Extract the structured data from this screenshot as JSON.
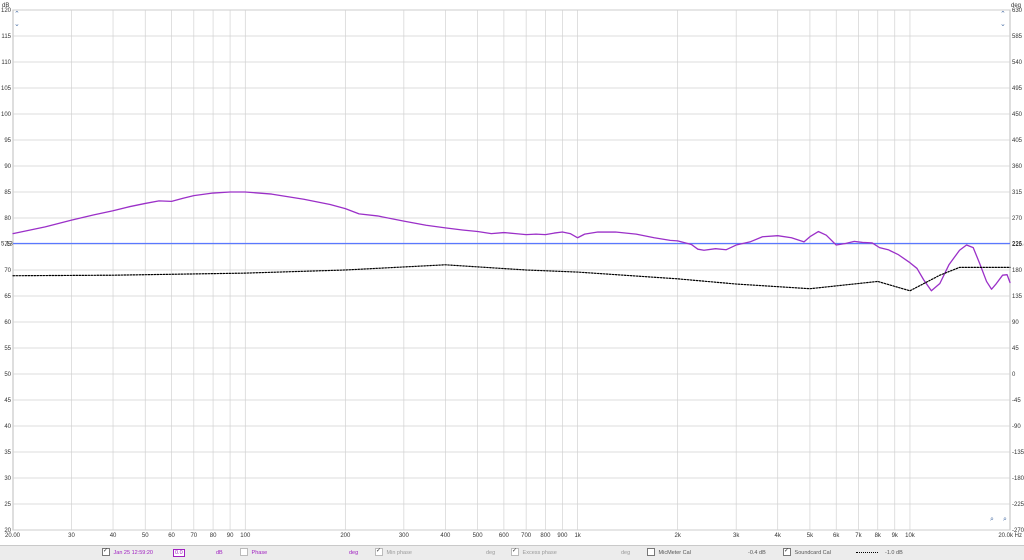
{
  "chart_data": {
    "type": "line",
    "xscale": "log",
    "xlim": [
      20,
      20000
    ],
    "ylim_left": [
      20,
      120
    ],
    "ylim_right": [
      -270,
      630
    ],
    "yaxis_left_unit": "dB",
    "yaxis_right_unit": "deg",
    "x_ticks": [
      {
        "v": 30,
        "label": "30"
      },
      {
        "v": 40,
        "label": "40"
      },
      {
        "v": 50,
        "label": "50"
      },
      {
        "v": 60,
        "label": "60"
      },
      {
        "v": 70,
        "label": "70"
      },
      {
        "v": 80,
        "label": "80"
      },
      {
        "v": 90,
        "label": "90"
      },
      {
        "v": 100,
        "label": "100"
      },
      {
        "v": 200,
        "label": "200"
      },
      {
        "v": 300,
        "label": "300"
      },
      {
        "v": 400,
        "label": "400"
      },
      {
        "v": 500,
        "label": "500"
      },
      {
        "v": 600,
        "label": "600"
      },
      {
        "v": 700,
        "label": "700"
      },
      {
        "v": 800,
        "label": "800"
      },
      {
        "v": 900,
        "label": "900"
      },
      {
        "v": 1000,
        "label": "1k"
      },
      {
        "v": 2000,
        "label": "2k"
      },
      {
        "v": 3000,
        "label": "3k"
      },
      {
        "v": 4000,
        "label": "4k"
      },
      {
        "v": 5000,
        "label": "5k"
      },
      {
        "v": 6000,
        "label": "6k"
      },
      {
        "v": 7000,
        "label": "7k"
      },
      {
        "v": 8000,
        "label": "8k"
      },
      {
        "v": 9000,
        "label": "9k"
      },
      {
        "v": 10000,
        "label": "10k"
      }
    ],
    "x_min_label": "20.00",
    "x_max_label": "20.0k Hz",
    "y_left_ticks": [
      "120",
      "115",
      "110",
      "105",
      "100",
      "95",
      "90",
      "85",
      "80",
      "75",
      "70",
      "65",
      "60",
      "55",
      "50",
      "45",
      "40",
      "35",
      "30",
      "25",
      "20"
    ],
    "y_right_ticks": [
      "630",
      "585",
      "540",
      "495",
      "450",
      "405",
      "360",
      "315",
      "270",
      "225",
      "180",
      "135",
      "90",
      "45",
      "0",
      "-45",
      "-90",
      "-135",
      "-180",
      "-225",
      "-270"
    ],
    "y_left_top_unit_label": "dB",
    "y_right_top_unit_label": "deg",
    "cursor_level_left": 75.1,
    "cursor_level_right": 226.4,
    "cursor_label_left": "5.13",
    "cursor_label_right": "226.4",
    "series": [
      {
        "name": "Jan 25 12:59:20",
        "color": "#9b30c8",
        "style": "solid",
        "points": [
          [
            20,
            77.0
          ],
          [
            25,
            78.3
          ],
          [
            30,
            79.6
          ],
          [
            35,
            80.6
          ],
          [
            40,
            81.4
          ],
          [
            45,
            82.2
          ],
          [
            50,
            82.8
          ],
          [
            55,
            83.3
          ],
          [
            60,
            83.2
          ],
          [
            65,
            83.8
          ],
          [
            70,
            84.3
          ],
          [
            80,
            84.8
          ],
          [
            90,
            85.0
          ],
          [
            100,
            85.0
          ],
          [
            120,
            84.6
          ],
          [
            150,
            83.6
          ],
          [
            180,
            82.6
          ],
          [
            200,
            81.8
          ],
          [
            220,
            80.8
          ],
          [
            250,
            80.4
          ],
          [
            300,
            79.4
          ],
          [
            350,
            78.6
          ],
          [
            400,
            78.1
          ],
          [
            450,
            77.7
          ],
          [
            500,
            77.4
          ],
          [
            550,
            77.0
          ],
          [
            600,
            77.2
          ],
          [
            650,
            77.0
          ],
          [
            700,
            76.8
          ],
          [
            750,
            76.9
          ],
          [
            800,
            76.8
          ],
          [
            850,
            77.1
          ],
          [
            900,
            77.3
          ],
          [
            950,
            77.0
          ],
          [
            1000,
            76.2
          ],
          [
            1050,
            76.9
          ],
          [
            1150,
            77.3
          ],
          [
            1300,
            77.3
          ],
          [
            1500,
            76.9
          ],
          [
            1700,
            76.2
          ],
          [
            1900,
            75.7
          ],
          [
            2000,
            75.6
          ],
          [
            2200,
            74.9
          ],
          [
            2300,
            74.0
          ],
          [
            2400,
            73.8
          ],
          [
            2600,
            74.1
          ],
          [
            2800,
            73.9
          ],
          [
            3000,
            74.8
          ],
          [
            3300,
            75.4
          ],
          [
            3600,
            76.4
          ],
          [
            4000,
            76.6
          ],
          [
            4400,
            76.2
          ],
          [
            4800,
            75.4
          ],
          [
            5000,
            76.4
          ],
          [
            5300,
            77.4
          ],
          [
            5600,
            76.7
          ],
          [
            6000,
            74.8
          ],
          [
            6400,
            75.1
          ],
          [
            6800,
            75.5
          ],
          [
            7200,
            75.3
          ],
          [
            7700,
            75.2
          ],
          [
            8100,
            74.3
          ],
          [
            8600,
            73.9
          ],
          [
            9200,
            73.0
          ],
          [
            10000,
            71.4
          ],
          [
            10500,
            70.3
          ],
          [
            11000,
            68.1
          ],
          [
            11600,
            66.0
          ],
          [
            12300,
            67.4
          ],
          [
            13100,
            71.0
          ],
          [
            14100,
            73.8
          ],
          [
            14800,
            74.8
          ],
          [
            15500,
            74.3
          ],
          [
            16200,
            71.3
          ],
          [
            17000,
            67.8
          ],
          [
            17600,
            66.3
          ],
          [
            18200,
            67.4
          ],
          [
            19000,
            69.0
          ],
          [
            19600,
            69.1
          ],
          [
            20000,
            67.6
          ]
        ]
      },
      {
        "name": "Soundcard Cal",
        "color": "#000000",
        "style": "dotted",
        "points": [
          [
            20,
            68.9
          ],
          [
            40,
            69.0
          ],
          [
            100,
            69.4
          ],
          [
            200,
            70.0
          ],
          [
            400,
            71.0
          ],
          [
            700,
            70.0
          ],
          [
            1000,
            69.6
          ],
          [
            2000,
            68.3
          ],
          [
            3000,
            67.3
          ],
          [
            5000,
            66.4
          ],
          [
            8000,
            67.8
          ],
          [
            10000,
            66.0
          ],
          [
            12300,
            69.0
          ],
          [
            14100,
            70.5
          ],
          [
            20000,
            70.5
          ]
        ]
      }
    ]
  },
  "legend": {
    "measurement_name": "Jan 25 12:59:20",
    "measurement_offset": "0.0",
    "measurement_unit": "dB",
    "phase_label": "Phase",
    "phase_unit": "deg",
    "min_phase_label": "Min phase",
    "min_phase_unit": "deg",
    "excess_phase_label": "Excess phase",
    "excess_phase_unit": "deg",
    "mic_cal_label": "MicMeter Cal",
    "mic_cal_value": "-0.4 dB",
    "soundcard_cal_label": "Soundcard Cal",
    "soundcard_cal_value": "-1.0 dB"
  },
  "colors": {
    "grid": "#d2d2d2",
    "cursor": "#5a78ff",
    "measurement": "#9b30c8",
    "soundcard": "#000000"
  }
}
